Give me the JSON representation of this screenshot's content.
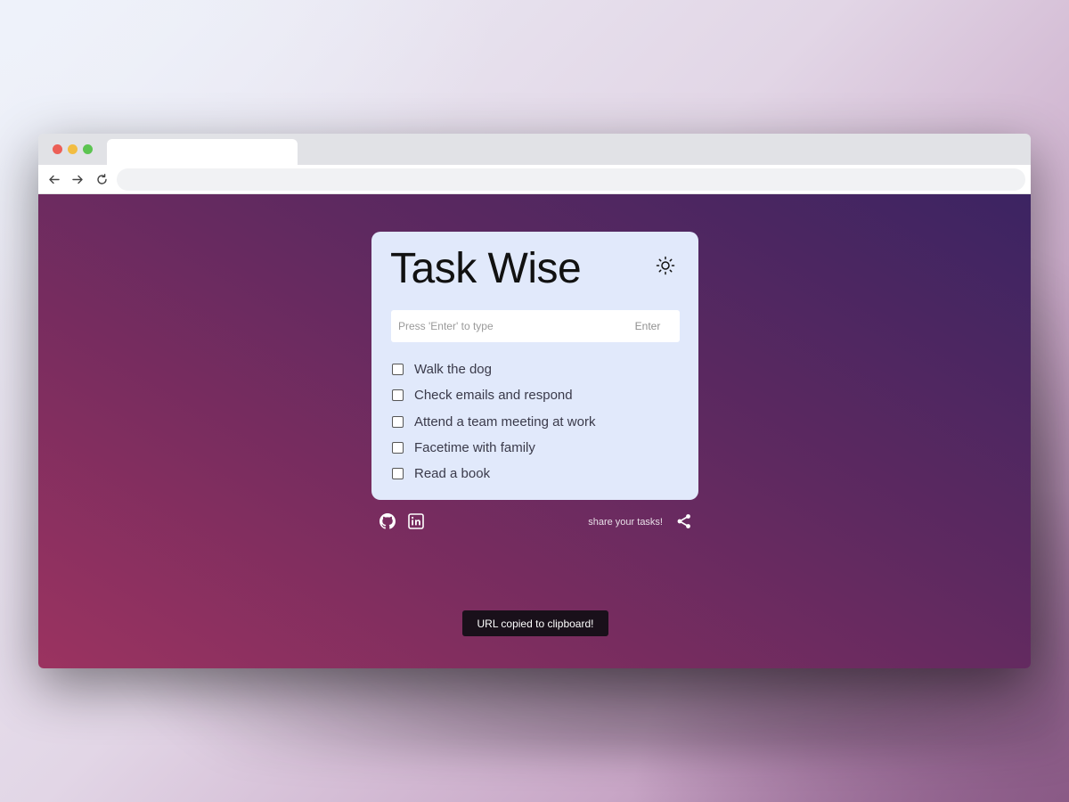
{
  "app": {
    "title": "Task Wise"
  },
  "input": {
    "placeholder": "Press 'Enter' to type",
    "value": "",
    "enter_label": "Enter"
  },
  "tasks": [
    {
      "label": "Walk the dog",
      "done": false
    },
    {
      "label": "Check emails and respond",
      "done": false
    },
    {
      "label": "Attend a team meeting at work",
      "done": false
    },
    {
      "label": "Facetime with family",
      "done": false
    },
    {
      "label": "Read a book",
      "done": false
    }
  ],
  "footer": {
    "share_text": "share your tasks!"
  },
  "toast": {
    "message": "URL copied to clipboard!"
  },
  "icons": {
    "theme": "sun-icon",
    "github": "github-icon",
    "linkedin": "linkedin-icon",
    "share": "share-icon"
  },
  "colors": {
    "card_bg": "#e1e9fb",
    "page_gradient_start": "#9b3360",
    "page_gradient_end": "#3c2462",
    "toast_bg": "#19101a"
  }
}
